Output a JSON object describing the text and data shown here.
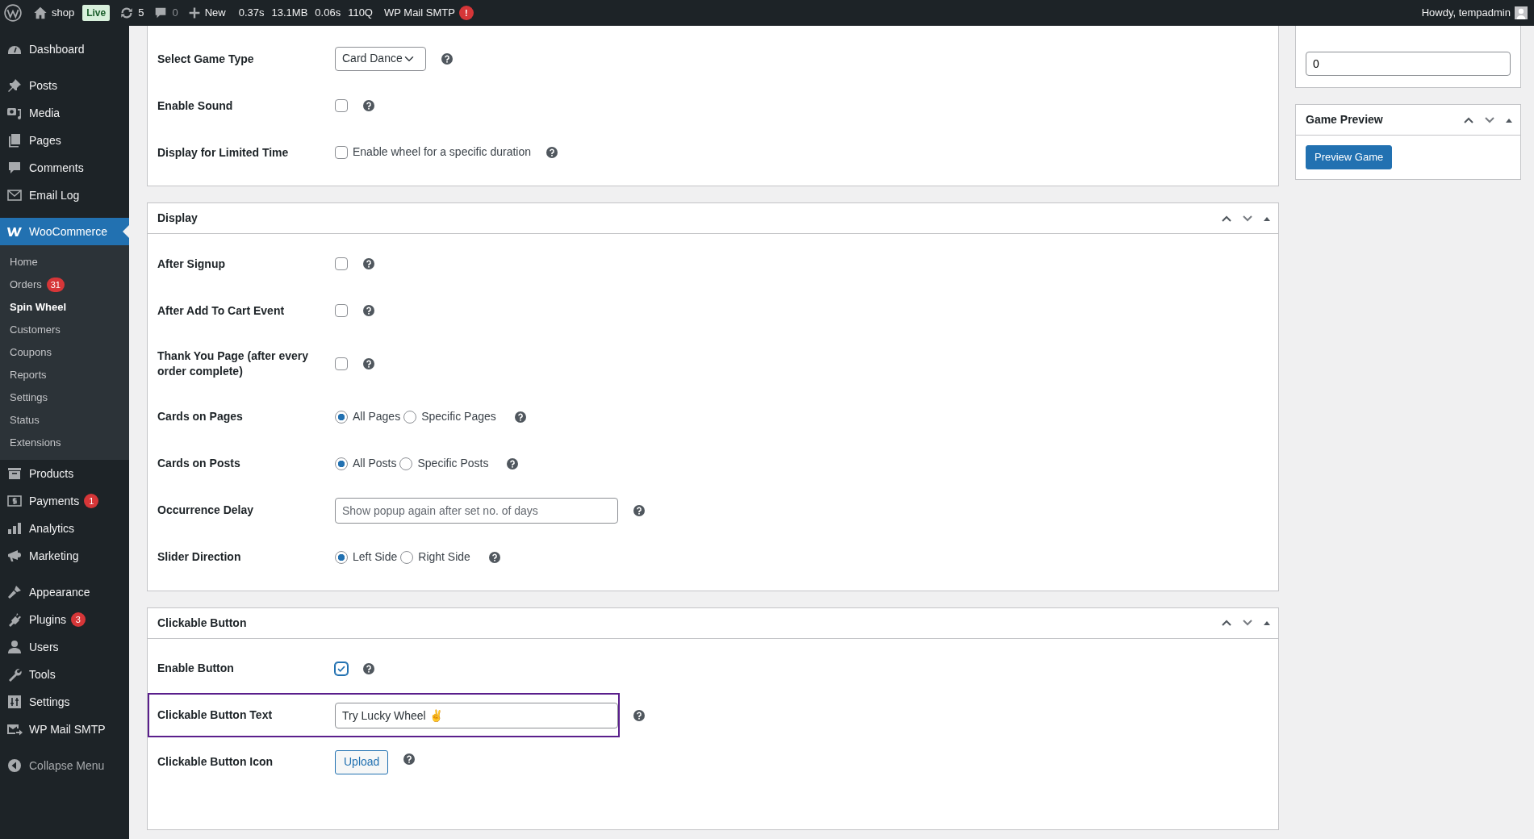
{
  "admin_bar": {
    "site": "shop",
    "site_badge": "Live",
    "updates": "5",
    "comments": "0",
    "new": "New",
    "stats": [
      "0.37s",
      "13.1MB",
      "0.06s",
      "110Q"
    ],
    "smtp": {
      "label": "WP Mail SMTP",
      "alert": "!"
    },
    "greeting": "Howdy, tempadmin"
  },
  "sidebar": {
    "groups": [
      [
        {
          "label": "Dashboard",
          "selected": false
        }
      ],
      [
        {
          "label": "Posts",
          "selected": false
        },
        {
          "label": "Media",
          "selected": false
        },
        {
          "label": "Pages",
          "selected": false
        },
        {
          "label": "Comments",
          "selected": false
        },
        {
          "label": "Email Log",
          "selected": false
        }
      ],
      [
        {
          "label": "WooCommerce",
          "selected": true,
          "children": [
            {
              "label": "Home",
              "selected": false
            },
            {
              "label": "Orders",
              "badge": "31",
              "selected": false
            },
            {
              "label": "Spin Wheel",
              "selected": true
            },
            {
              "label": "Customers",
              "selected": false
            },
            {
              "label": "Coupons",
              "selected": false
            },
            {
              "label": "Reports",
              "selected": false
            },
            {
              "label": "Settings",
              "selected": false
            },
            {
              "label": "Status",
              "selected": false
            },
            {
              "label": "Extensions",
              "selected": false
            }
          ]
        },
        {
          "label": "Products",
          "selected": false
        },
        {
          "label": "Payments",
          "badge": "1",
          "selected": false
        },
        {
          "label": "Analytics",
          "selected": false
        },
        {
          "label": "Marketing",
          "selected": false
        }
      ],
      [
        {
          "label": "Appearance",
          "selected": false
        },
        {
          "label": "Plugins",
          "badge": "3",
          "selected": false
        },
        {
          "label": "Users",
          "selected": false
        },
        {
          "label": "Tools",
          "selected": false
        },
        {
          "label": "Settings",
          "selected": false
        },
        {
          "label": "WP Mail SMTP",
          "selected": false
        }
      ]
    ],
    "collapse": "Collapse Menu"
  },
  "main_panels": [
    {
      "rows": [
        {
          "kind": "select",
          "label": "Select Game Type",
          "value": "Card Dance"
        },
        {
          "kind": "checkbox",
          "label": "Enable Sound",
          "checked": false
        },
        {
          "kind": "checkbox",
          "label": "Display for Limited Time",
          "checked": false,
          "caption": "Enable wheel for a specific duration"
        }
      ]
    },
    {
      "title": "Display",
      "rows": [
        {
          "kind": "checkbox",
          "label": "After Signup",
          "checked": false
        },
        {
          "kind": "checkbox",
          "label": "After Add To Cart Event",
          "checked": false
        },
        {
          "kind": "checkbox",
          "label": "Thank You Page (after every order complete)",
          "checked": false
        },
        {
          "kind": "radio",
          "label": "Cards on Pages",
          "options": [
            {
              "label": "All Pages",
              "selected": true
            },
            {
              "label": "Specific Pages",
              "selected": false
            }
          ]
        },
        {
          "kind": "radio",
          "label": "Cards on Posts",
          "options": [
            {
              "label": "All Posts",
              "selected": true
            },
            {
              "label": "Specific Posts",
              "selected": false
            }
          ]
        },
        {
          "kind": "text",
          "label": "Occurrence Delay",
          "placeholder": "Show popup again after set no. of days",
          "focused": false
        },
        {
          "kind": "radio",
          "label": "Slider Direction",
          "options": [
            {
              "label": "Left Side",
              "selected": true
            },
            {
              "label": "Right Side",
              "selected": false
            }
          ]
        }
      ]
    },
    {
      "title": "Clickable Button",
      "rows": [
        {
          "kind": "checkbox",
          "label": "Enable Button",
          "checked": true
        },
        {
          "kind": "text",
          "label": "Clickable Button Text",
          "value": "Try Lucky Wheel ✌️",
          "focused": true
        },
        {
          "kind": "upload",
          "label": "Clickable Button Icon",
          "button": "Upload"
        }
      ]
    }
  ],
  "side_panels": [
    {
      "kind": "input",
      "value": "0"
    },
    {
      "kind": "button",
      "title": "Game Preview",
      "button": "Preview Game"
    }
  ]
}
